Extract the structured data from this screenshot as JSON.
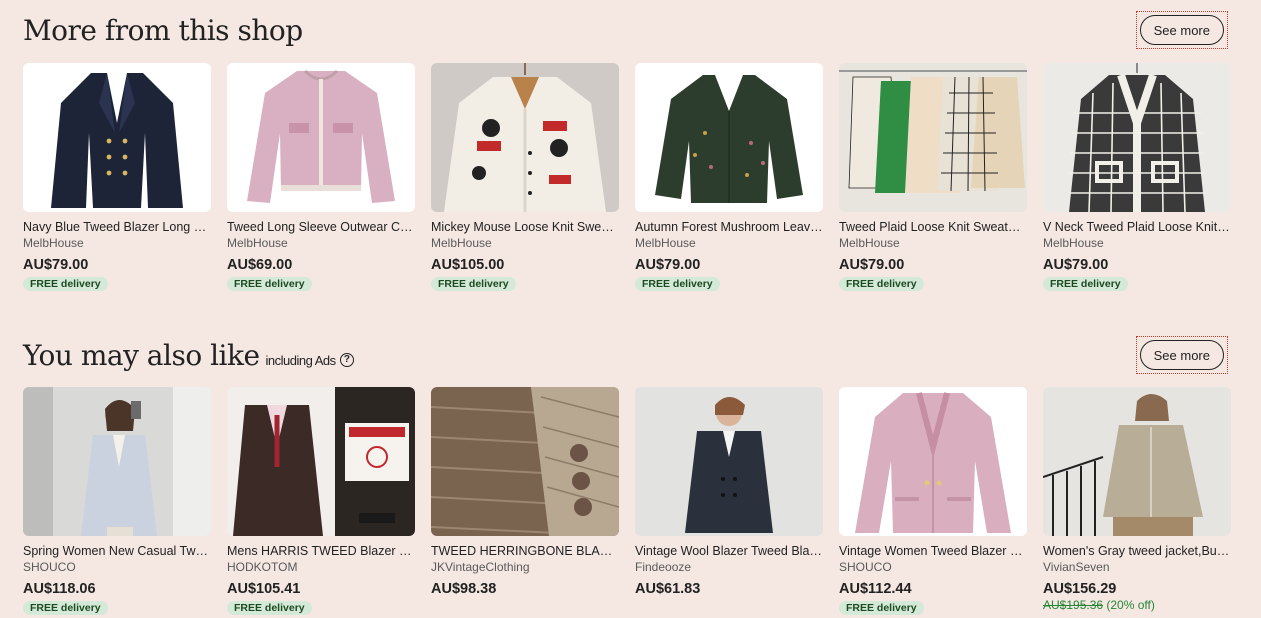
{
  "shop_section": {
    "title": "More from this shop",
    "see_more": "See more",
    "items": [
      {
        "title": "Navy Blue Tweed Blazer Long Sleeve",
        "shop": "MelbHouse",
        "price": "AU$79.00",
        "delivery": "FREE delivery"
      },
      {
        "title": "Tweed Long Sleeve Outwear Crop",
        "shop": "MelbHouse",
        "price": "AU$69.00",
        "delivery": "FREE delivery"
      },
      {
        "title": "Mickey Mouse Loose Knit Sweater Cardigan",
        "shop": "MelbHouse",
        "price": "AU$105.00",
        "delivery": "FREE delivery"
      },
      {
        "title": "Autumn Forest Mushroom Leaves Cardigan",
        "shop": "MelbHouse",
        "price": "AU$79.00",
        "delivery": "FREE delivery"
      },
      {
        "title": "Tweed Plaid Loose Knit Sweater Cardigan",
        "shop": "MelbHouse",
        "price": "AU$79.00",
        "delivery": "FREE delivery"
      },
      {
        "title": "V Neck Tweed Plaid Loose Knit Cardigan",
        "shop": "MelbHouse",
        "price": "AU$79.00",
        "delivery": "FREE delivery"
      }
    ]
  },
  "like_section": {
    "title": "You may also like",
    "sub_note": "including Ads",
    "see_more": "See more",
    "items": [
      {
        "title": "Spring Women New Casual Tweed Blazer",
        "shop": "SHOUCO",
        "price": "AU$118.06",
        "delivery": "FREE delivery"
      },
      {
        "title": "Mens HARRIS TWEED Blazer Coat",
        "shop": "HODKOTOM",
        "price": "AU$105.41",
        "delivery": "FREE delivery"
      },
      {
        "title": "TWEED HERRINGBONE BLAZER",
        "shop": "JKVintageClothing",
        "price": "AU$98.38",
        "delivery": ""
      },
      {
        "title": "Vintage Wool Blazer Tweed Blazer",
        "shop": "Findeooze",
        "price": "AU$61.83",
        "delivery": ""
      },
      {
        "title": "Vintage Women Tweed Blazer Jacket",
        "shop": "SHOUCO",
        "price": "AU$112.44",
        "delivery": "FREE delivery"
      },
      {
        "title": "Women's Gray tweed jacket,Buttons",
        "shop": "VivianSeven",
        "price": "AU$156.29",
        "original_price": "AU$195.36",
        "discount": "(20% off)",
        "delivery": ""
      }
    ]
  },
  "colors": {
    "background": "#f5e8e3",
    "badge_bg": "#d4e9d7",
    "discount_green": "#258635"
  }
}
